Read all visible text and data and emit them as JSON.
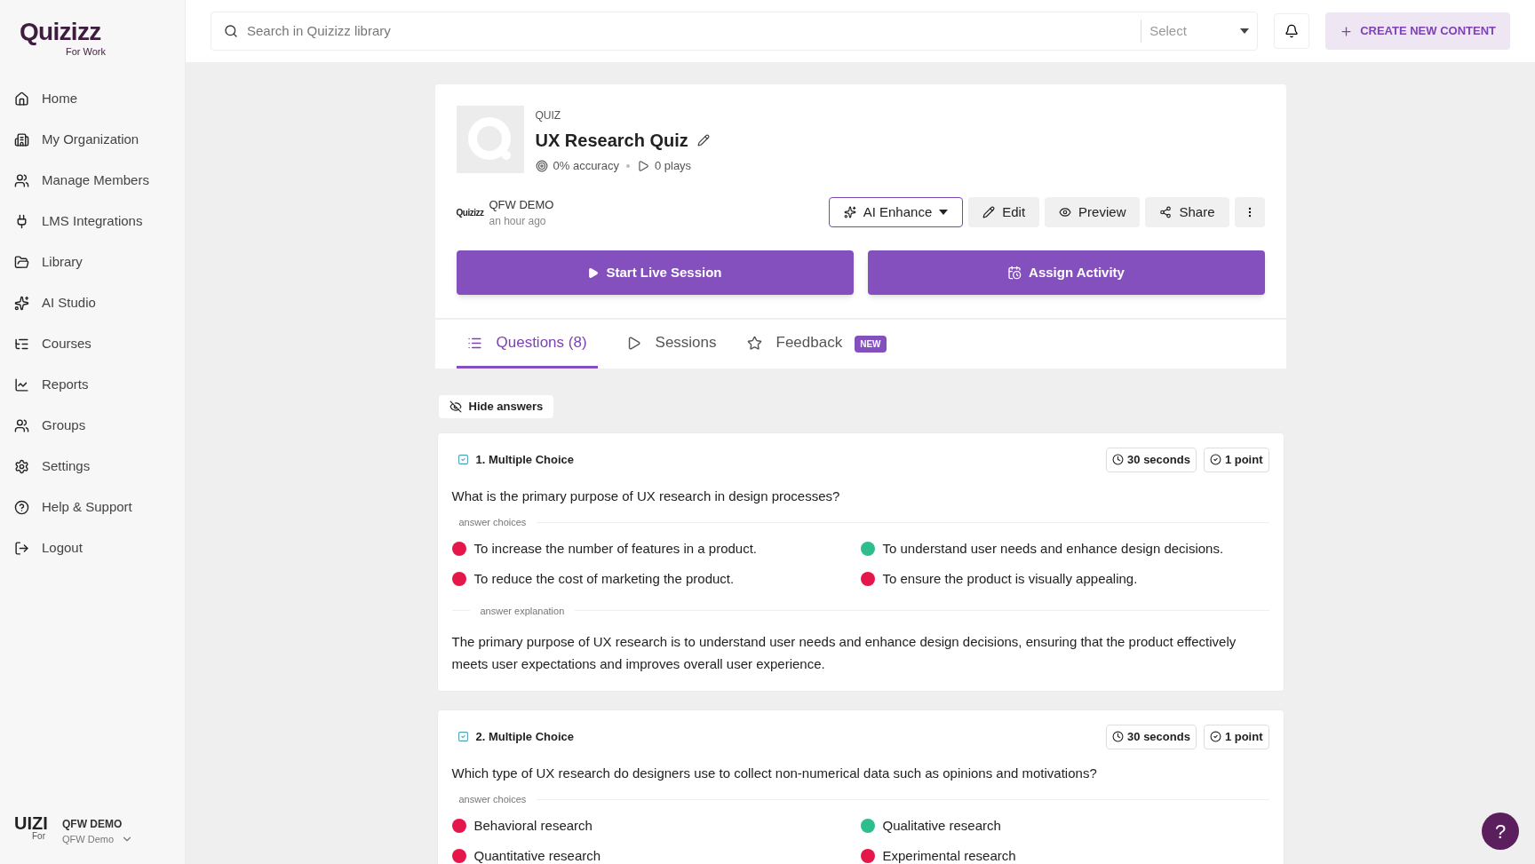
{
  "logo": {
    "name": "Quizizz",
    "sub": "For Work"
  },
  "sidebar": {
    "items": [
      {
        "label": "Home",
        "kind": "home"
      },
      {
        "label": "My Organization",
        "kind": "org"
      },
      {
        "label": "Manage Members",
        "kind": "members"
      },
      {
        "label": "LMS Integrations",
        "kind": "plug"
      },
      {
        "label": "Library",
        "kind": "folder"
      },
      {
        "label": "AI Studio",
        "kind": "ai"
      },
      {
        "label": "Courses",
        "kind": "courses"
      },
      {
        "label": "Reports",
        "kind": "chart"
      },
      {
        "label": "Groups",
        "kind": "members"
      },
      {
        "label": "Settings",
        "kind": "settings"
      },
      {
        "label": "Help & Support",
        "kind": "help"
      },
      {
        "label": "Logout",
        "kind": "logout"
      }
    ],
    "account": {
      "logo_text": "UIZI",
      "logo_sub": "For",
      "name": "QFW DEMO",
      "workspace": "QFW Demo"
    }
  },
  "topbar": {
    "search": {
      "placeholder": "Search in Quizizz library"
    },
    "select": {
      "placeholder": "Select"
    },
    "create_button": "CREATE NEW CONTENT"
  },
  "quiz": {
    "type": "QUIZ",
    "title": "UX Research Quiz",
    "accuracy": "0% accuracy",
    "plays": "0 plays",
    "author": {
      "logo": "Quizizz",
      "name": "QFW DEMO",
      "time": "an hour ago"
    },
    "actions": [
      "AI Enhance",
      "Edit",
      "Preview",
      "Share"
    ],
    "start_button": "Start Live Session",
    "assign_button": "Assign Activity"
  },
  "tabs": [
    {
      "label": "Questions (8)",
      "kind": "questions",
      "selected": true
    },
    {
      "label": "Sessions",
      "kind": "sessions",
      "selected": false
    },
    {
      "label": "Feedback",
      "kind": "feedback",
      "selected": false,
      "badge": "NEW"
    }
  ],
  "hide_answers": "Hide answers",
  "questions": [
    {
      "title": "1. Multiple Choice",
      "time": "30 seconds",
      "points": "1 point",
      "text": "What is the primary purpose of UX research in design processes?",
      "choices_label": "answer choices",
      "choices": [
        {
          "text": "To increase the number of features in a product.",
          "correct": false
        },
        {
          "text": "To understand user needs and enhance design decisions.",
          "correct": true
        },
        {
          "text": "To reduce the cost of marketing the product.",
          "correct": false
        },
        {
          "text": "To ensure the product is visually appealing.",
          "correct": false
        }
      ],
      "explanation_label": "answer explanation",
      "explanation": "The primary purpose of UX research is to understand user needs and enhance design decisions, ensuring that the product effectively meets user expectations and improves overall user experience."
    },
    {
      "title": "2. Multiple Choice",
      "time": "30 seconds",
      "points": "1 point",
      "text": "Which type of UX research do designers use to collect non-numerical data such as opinions and motivations?",
      "choices_label": "answer choices",
      "choices": [
        {
          "text": "Behavioral research",
          "correct": false
        },
        {
          "text": "Qualitative research",
          "correct": true
        },
        {
          "text": "Quantitative research",
          "correct": false
        },
        {
          "text": "Experimental research",
          "correct": false
        }
      ]
    }
  ],
  "help_button": "?"
}
